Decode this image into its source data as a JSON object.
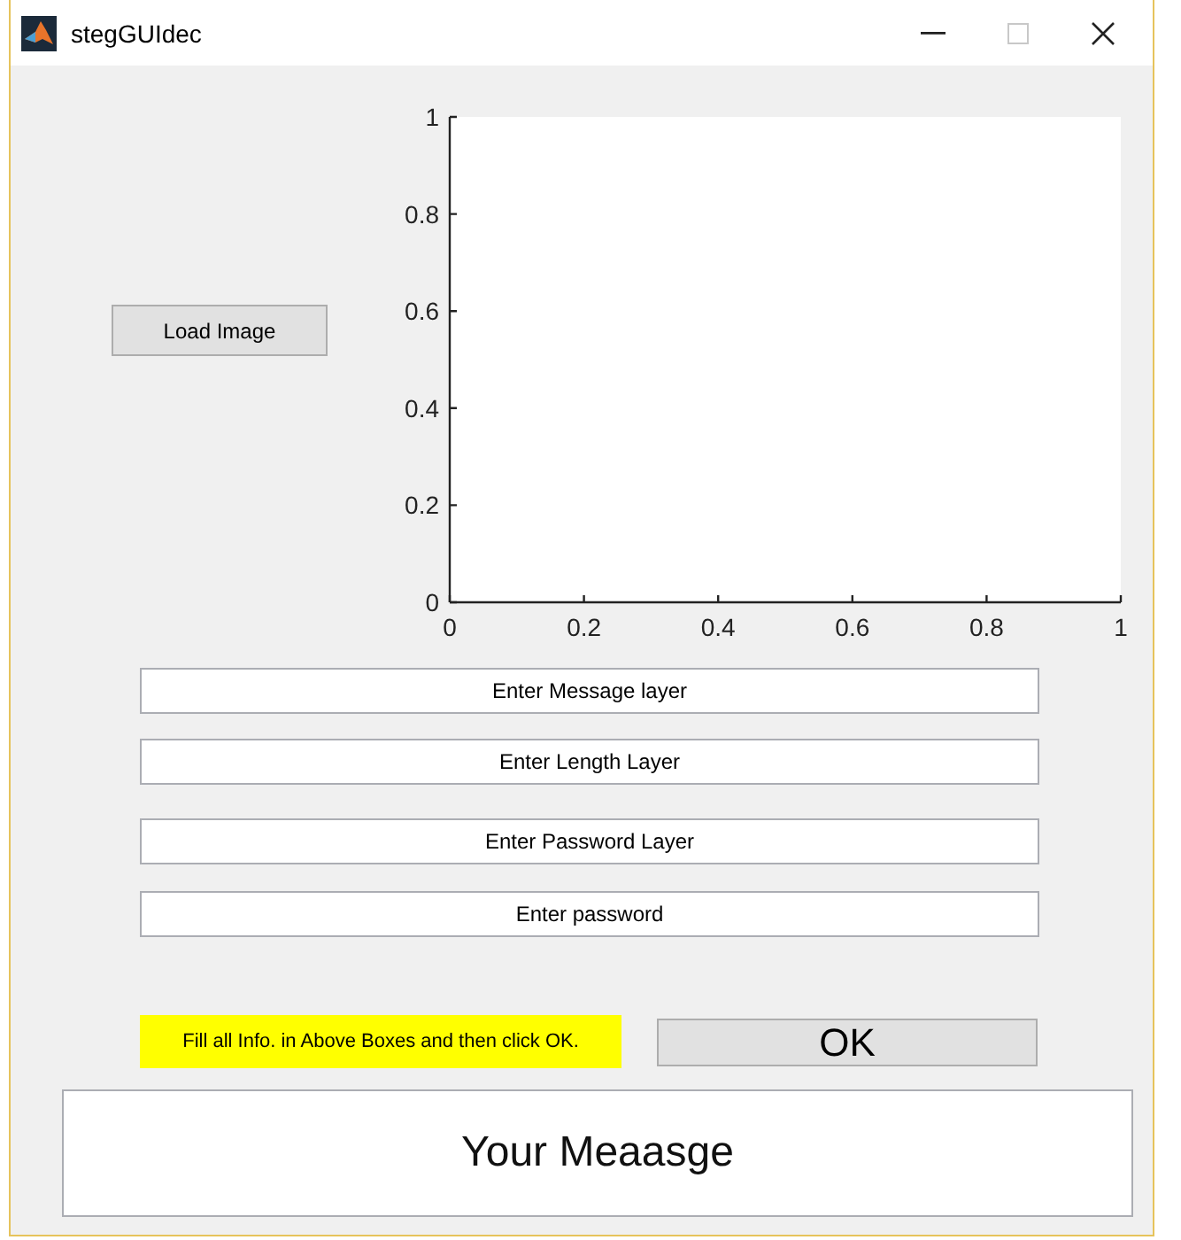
{
  "window": {
    "title": "stegGUIdec"
  },
  "load_button": {
    "label": "Load Image"
  },
  "axes": {
    "chart_data": {
      "type": "line",
      "xlim": [
        0,
        1
      ],
      "ylim": [
        0,
        1
      ],
      "xticks": [
        0,
        0.2,
        0.4,
        0.6,
        0.8,
        1
      ],
      "yticks": [
        0,
        0.2,
        0.4,
        0.6,
        0.8,
        1
      ]
    }
  },
  "fields": [
    {
      "value": "Enter Message layer"
    },
    {
      "value": "Enter Length Layer"
    },
    {
      "value": "Enter Password Layer"
    },
    {
      "value": "Enter password"
    }
  ],
  "instruction": "Fill all Info. in Above Boxes and then click OK.",
  "ok_button": {
    "label": "OK"
  },
  "message": "Your Meaasge"
}
